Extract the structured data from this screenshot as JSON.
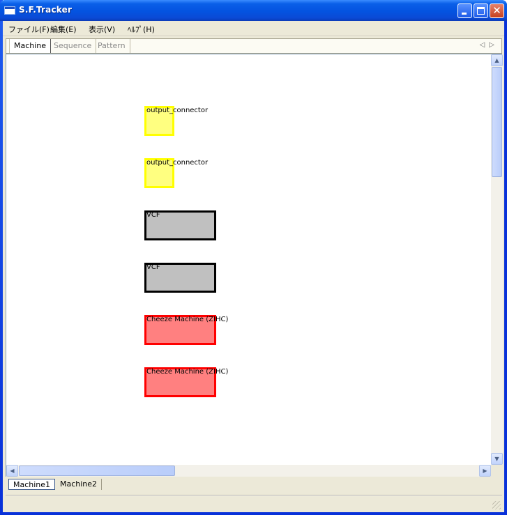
{
  "window": {
    "title": "S.F.Tracker"
  },
  "menu": [
    {
      "label": "ファイル(F)"
    },
    {
      "label": "編集(E)"
    },
    {
      "label": "表示(V)"
    },
    {
      "label": "ﾍﾙﾌﾟ(H)"
    }
  ],
  "tabs": [
    {
      "label": "Machine",
      "active": true
    },
    {
      "label": "Sequence",
      "active": false
    },
    {
      "label": "Pattern",
      "active": false
    }
  ],
  "machines": [
    {
      "label": "output_connector",
      "kind": "output",
      "fill": "#ffff80",
      "border": "#ffff00"
    },
    {
      "label": "output_connector",
      "kind": "output",
      "fill": "#ffff80",
      "border": "#ffff00"
    },
    {
      "label": "VCF",
      "kind": "effect",
      "fill": "#c0c0c0",
      "border": "#000000"
    },
    {
      "label": "VCF",
      "kind": "effect",
      "fill": "#c0c0c0",
      "border": "#000000"
    },
    {
      "label": "Cheeze Machine (ZIHC)",
      "kind": "generator",
      "fill": "#ff8080",
      "border": "#ff0000"
    },
    {
      "label": "Cheeze Machine (ZIHC)",
      "kind": "generator",
      "fill": "#ff8080",
      "border": "#ff0000"
    }
  ],
  "bottom_tabs": [
    {
      "label": "Machine1",
      "active": true
    },
    {
      "label": "Machine2",
      "active": false
    }
  ],
  "status": {
    "text": ""
  }
}
